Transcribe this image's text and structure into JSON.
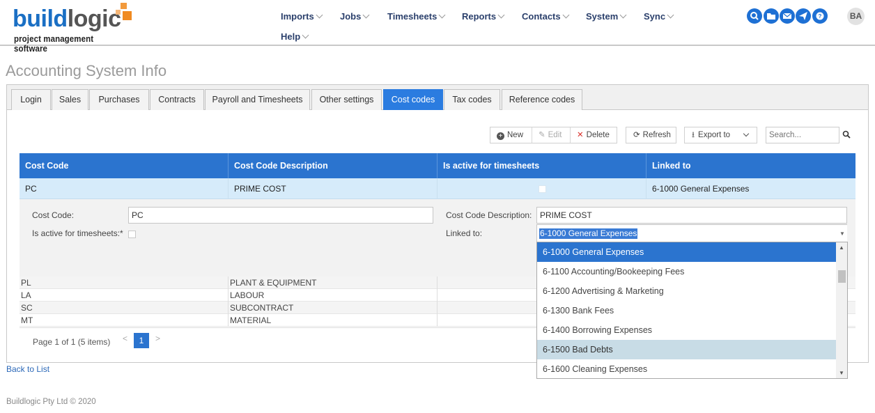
{
  "header": {
    "logo_main_1": "build",
    "logo_main_2": "logic",
    "logo_sub": "project management software",
    "nav": [
      {
        "label": "Imports"
      },
      {
        "label": "Jobs"
      },
      {
        "label": "Timesheets"
      },
      {
        "label": "Reports"
      },
      {
        "label": "Contacts"
      },
      {
        "label": "System"
      },
      {
        "label": "Sync"
      },
      {
        "label": "Help"
      }
    ],
    "icons": [
      "search-icon",
      "folder-icon",
      "mail-icon",
      "send-icon",
      "help-icon"
    ],
    "avatar_initials": "BA",
    "accent": "#1e70d4"
  },
  "page_title": "Accounting System Info",
  "tabs": [
    {
      "label": "Login"
    },
    {
      "label": "Sales"
    },
    {
      "label": "Purchases"
    },
    {
      "label": "Contracts"
    },
    {
      "label": "Payroll and Timesheets"
    },
    {
      "label": "Other settings"
    },
    {
      "label": "Cost codes"
    },
    {
      "label": "Tax codes"
    },
    {
      "label": "Reference codes"
    }
  ],
  "active_tab": "Cost codes",
  "toolbar": {
    "new_label": "New",
    "edit_label": "Edit",
    "delete_label": "Delete",
    "refresh_label": "Refresh",
    "export_label": "Export to",
    "search_placeholder": "Search..."
  },
  "grid": {
    "columns": [
      "Cost Code",
      "Cost Code Description",
      "Is active for timesheets",
      "Linked to"
    ],
    "selected_row": {
      "code": "PC",
      "description": "PRIME COST",
      "active": false,
      "linked": "6-1000 General Expenses"
    },
    "rows": [
      {
        "code": "PL",
        "description": "PLANT & EQUIPMENT"
      },
      {
        "code": "LA",
        "description": "LABOUR"
      },
      {
        "code": "SC",
        "description": "SUBCONTRACT"
      },
      {
        "code": "MT",
        "description": "MATERIAL"
      }
    ],
    "pager_text": "Page 1 of 1 (5 items)",
    "current_page": "1"
  },
  "edit_form": {
    "cost_code_label": "Cost Code:",
    "cost_code_value": "PC",
    "description_label": "Cost Code Description:",
    "description_value": "PRIME COST",
    "active_label": "Is active for timesheets:*",
    "linked_label": "Linked to:",
    "linked_value": "6-1000 General Expenses"
  },
  "dropdown": {
    "options": [
      "6-1000 General Expenses",
      "6-1100 Accounting/Bookeeping Fees",
      "6-1200 Advertising & Marketing",
      "6-1300 Bank Fees",
      "6-1400 Borrowing Expenses",
      "6-1500 Bad Debts",
      "6-1600 Cleaning Expenses"
    ],
    "selected": "6-1000 General Expenses",
    "hovered": "6-1500 Bad Debts"
  },
  "back_link": "Back to List",
  "footer": "Buildlogic Pty Ltd © 2020"
}
